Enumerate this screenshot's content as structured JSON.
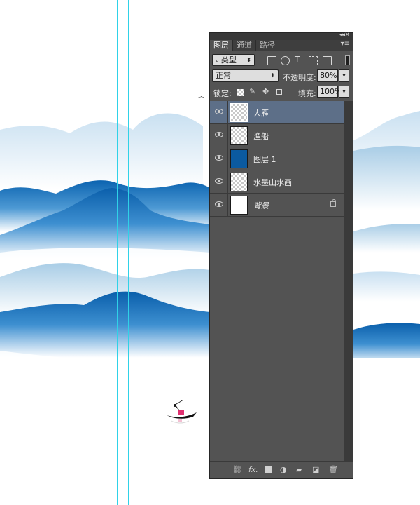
{
  "panel": {
    "tabs": [
      {
        "label": "图层"
      },
      {
        "label": "通道"
      },
      {
        "label": "路径"
      }
    ],
    "collapse_icon": "double-chevron-icon",
    "filter": {
      "label": "类型"
    },
    "blend_mode": "正常",
    "opacity_label": "不透明度:",
    "opacity_value": "80%",
    "lock_label": "锁定:",
    "fill_label": "填充:",
    "fill_value": "100%",
    "layers": [
      {
        "name": "大雁",
        "thumbnail": "transparent",
        "selected": true
      },
      {
        "name": "渔船",
        "thumbnail": "transparent",
        "selected": false
      },
      {
        "name": "图层 1",
        "thumbnail": "blue",
        "selected": false
      },
      {
        "name": "水墨山水画",
        "thumbnail": "transparent-mountain",
        "selected": false
      },
      {
        "name": "背景",
        "thumbnail": "white",
        "selected": false,
        "locked": true
      }
    ],
    "bottom_icons": [
      "link-icon",
      "fx-icon",
      "mask-icon",
      "adjustment-icon",
      "folder-icon",
      "new-layer-icon",
      "trash-icon"
    ],
    "fx_label": "fx."
  },
  "colors": {
    "panel_bg": "#535353",
    "selected_layer": "#5d6f88",
    "guide": "#2fd2e8",
    "mountain_blue": "#0a6fb8",
    "layer1_fill": "#0b5aa0"
  }
}
